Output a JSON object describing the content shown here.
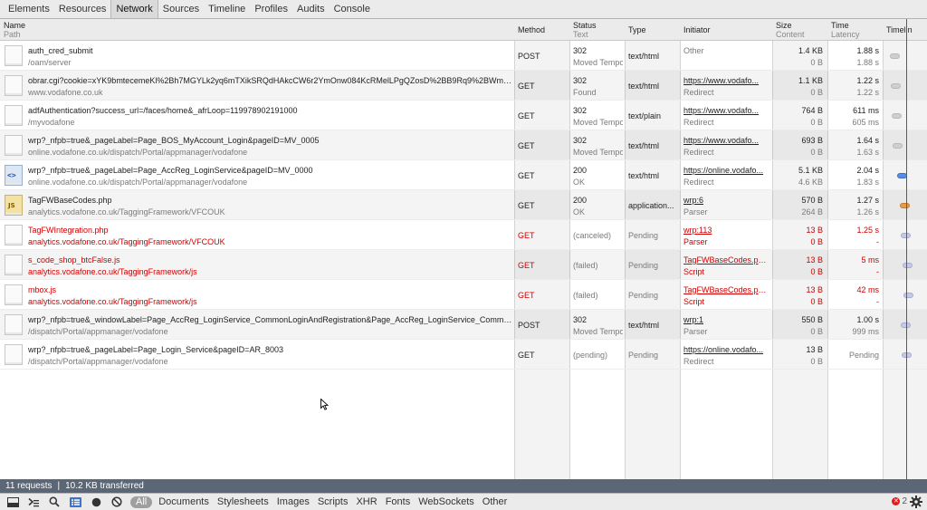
{
  "tabs": [
    "Elements",
    "Resources",
    "Network",
    "Sources",
    "Timeline",
    "Profiles",
    "Audits",
    "Console"
  ],
  "active_tab": "Network",
  "columns": {
    "name": {
      "label": "Name",
      "sub": "Path"
    },
    "method": {
      "label": "Method"
    },
    "status": {
      "label": "Status",
      "sub": "Text"
    },
    "type": {
      "label": "Type"
    },
    "initiator": {
      "label": "Initiator"
    },
    "size": {
      "label": "Size",
      "sub": "Content"
    },
    "time": {
      "label": "Time",
      "sub": "Latency"
    },
    "timeline": {
      "label": "Timelin"
    }
  },
  "requests": [
    {
      "name": "auth_cred_submit",
      "path": "/oam/server",
      "method": "POST",
      "status": "302",
      "status_text": "Moved Tempo",
      "type": "text/html",
      "initiator": "Other",
      "initiator_sub": "",
      "size": "1.4 KB",
      "content": "0 B",
      "time": "1.88 s",
      "latency": "1.88 s",
      "icon": "document-icon",
      "error": false
    },
    {
      "name": "obrar.cgi?cookie=xYK9bmtecemeKl%2Bh7MGYLk2yq6mTXikSRQdHAkcCW6r2YmOnw084KcRMelLPgQZosD%2BB9Rq9%2BWm3L4...",
      "path": "www.vodafone.co.uk",
      "method": "GET",
      "status": "302",
      "status_text": "Found",
      "type": "text/html",
      "initiator": "https://www.vodafo...",
      "initiator_sub": "Redirect",
      "size": "1.1 KB",
      "content": "0 B",
      "time": "1.22 s",
      "latency": "1.22 s",
      "icon": "document-icon",
      "error": false
    },
    {
      "name": "adfAuthentication?success_url=/faces/home&_afrLoop=119978902191000",
      "path": "/myvodafone",
      "method": "GET",
      "status": "302",
      "status_text": "Moved Tempo",
      "type": "text/plain",
      "initiator": "https://www.vodafo...",
      "initiator_sub": "Redirect",
      "size": "764 B",
      "content": "0 B",
      "time": "611 ms",
      "latency": "605 ms",
      "icon": "document-icon",
      "error": false
    },
    {
      "name": "wrp?_nfpb=true&_pageLabel=Page_BOS_MyAccount_Login&pageID=MV_0005",
      "path": "online.vodafone.co.uk/dispatch/Portal/appmanager/vodafone",
      "method": "GET",
      "status": "302",
      "status_text": "Moved Tempo",
      "type": "text/html",
      "initiator": "https://www.vodafo...",
      "initiator_sub": "Redirect",
      "size": "693 B",
      "content": "0 B",
      "time": "1.64 s",
      "latency": "1.63 s",
      "icon": "document-icon",
      "error": false
    },
    {
      "name": "wrp?_nfpb=true&_pageLabel=Page_AccReg_LoginService&pageID=MV_0000",
      "path": "online.vodafone.co.uk/dispatch/Portal/appmanager/vodafone",
      "method": "GET",
      "status": "200",
      "status_text": "OK",
      "type": "text/html",
      "initiator": "https://online.vodafo...",
      "initiator_sub": "Redirect",
      "size": "5.1 KB",
      "content": "4.6 KB",
      "time": "2.04 s",
      "latency": "1.83 s",
      "icon": "html-icon",
      "error": false
    },
    {
      "name": "TagFWBaseCodes.php",
      "path": "analytics.vodafone.co.uk/TaggingFramework/VFCOUK",
      "method": "GET",
      "status": "200",
      "status_text": "OK",
      "type": "application...",
      "initiator": "wrp:6",
      "initiator_sub": "Parser",
      "size": "570 B",
      "content": "264 B",
      "time": "1.27 s",
      "latency": "1.26 s",
      "icon": "js-icon",
      "error": false
    },
    {
      "name": "TagFWIntegration.php",
      "path": "analytics.vodafone.co.uk/TaggingFramework/VFCOUK",
      "method": "GET",
      "status": "(canceled)",
      "status_text": "",
      "type": "Pending",
      "initiator": "wrp:113",
      "initiator_sub": "Parser",
      "size": "13 B",
      "content": "0 B",
      "time": "1.25 s",
      "latency": "-",
      "icon": "document-icon",
      "error": true
    },
    {
      "name": "s_code_shop_btcFalse.js",
      "path": "analytics.vodafone.co.uk/TaggingFramework/js",
      "method": "GET",
      "status": "(failed)",
      "status_text": "",
      "type": "Pending",
      "initiator": "TagFWBaseCodes.ph...",
      "initiator_sub": "Script",
      "size": "13 B",
      "content": "0 B",
      "time": "5 ms",
      "latency": "-",
      "icon": "document-icon",
      "error": true
    },
    {
      "name": "mbox.js",
      "path": "analytics.vodafone.co.uk/TaggingFramework/js",
      "method": "GET",
      "status": "(failed)",
      "status_text": "",
      "type": "Pending",
      "initiator": "TagFWBaseCodes.ph...",
      "initiator_sub": "Script",
      "size": "13 B",
      "content": "0 B",
      "time": "42 ms",
      "latency": "-",
      "icon": "document-icon",
      "error": true
    },
    {
      "name": "wrp?_nfpb=true&_windowLabel=Page_AccReg_LoginService_CommonLoginAndRegistration&Page_AccReg_LoginService_Common...",
      "path": "/dispatch/Portal/appmanager/vodafone",
      "method": "POST",
      "status": "302",
      "status_text": "Moved Tempo",
      "type": "text/html",
      "initiator": "wrp:1",
      "initiator_sub": "Parser",
      "size": "550 B",
      "content": "0 B",
      "time": "1.00 s",
      "latency": "999 ms",
      "icon": "document-icon",
      "error": false
    },
    {
      "name": "wrp?_nfpb=true&_pageLabel=Page_Login_Service&pageID=AR_8003",
      "path": "/dispatch/Portal/appmanager/vodafone",
      "method": "GET",
      "status": "(pending)",
      "status_text": "",
      "type": "Pending",
      "initiator": "https://online.vodafo...",
      "initiator_sub": "Redirect",
      "size": "13 B",
      "content": "0 B",
      "time": "Pending",
      "latency": "",
      "icon": "document-icon",
      "error": false
    }
  ],
  "status_bar": {
    "requests": "11 requests",
    "separator": "|",
    "transferred": "10.2 KB transferred"
  },
  "filters": [
    "All",
    "Documents",
    "Stylesheets",
    "Images",
    "Scripts",
    "XHR",
    "Fonts",
    "WebSockets",
    "Other"
  ],
  "error_count": "2",
  "colors": {
    "error": "#d00000",
    "timeline_marker": "#4b4bcf",
    "status_bar": "#5b6676"
  }
}
